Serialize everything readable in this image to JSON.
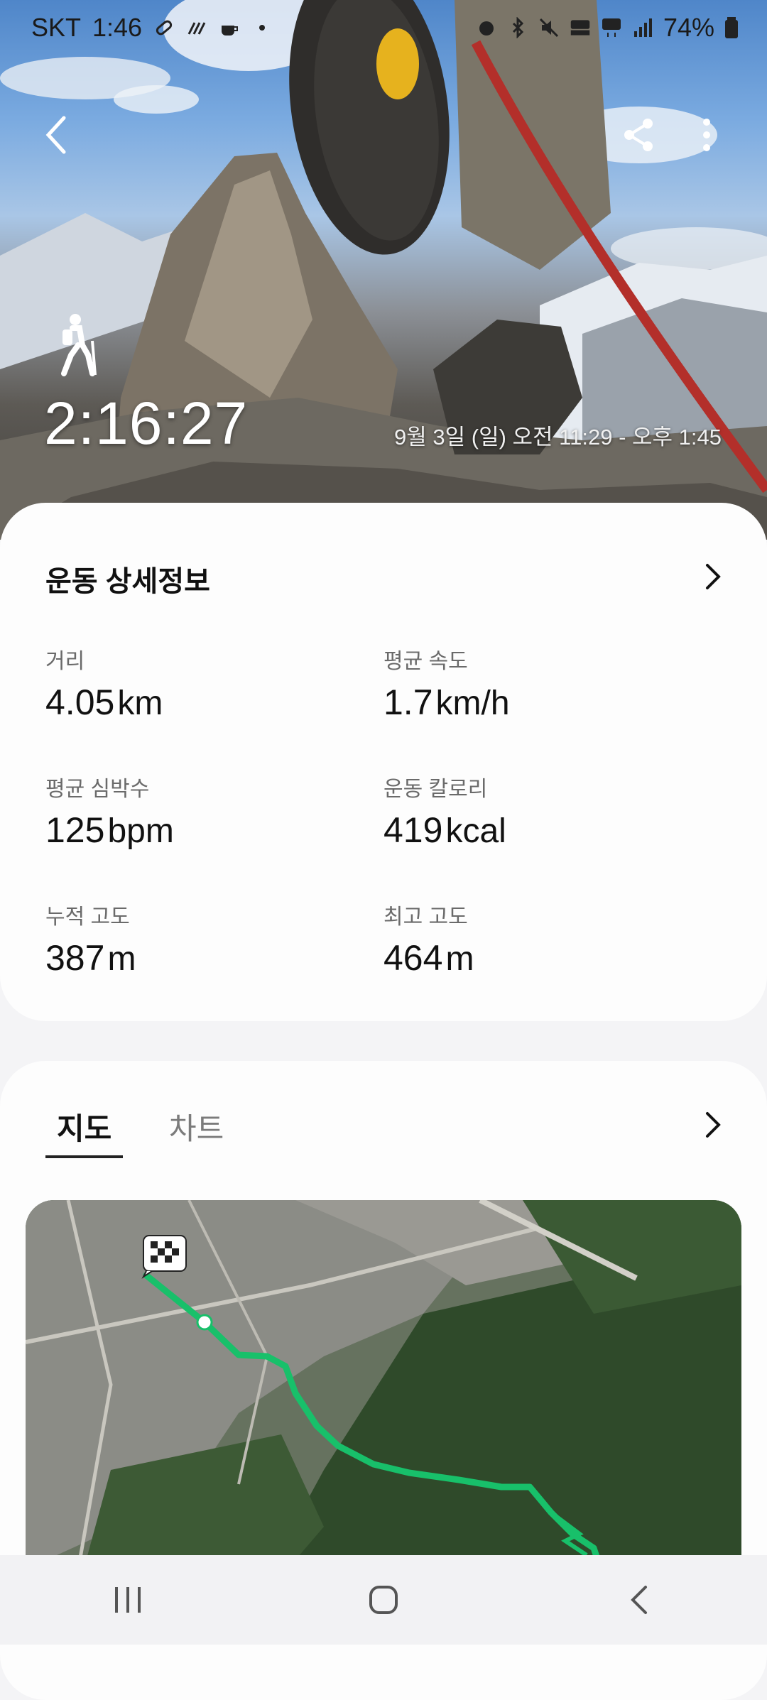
{
  "status_bar": {
    "carrier": "SKT",
    "time": "1:46",
    "battery": "74%",
    "left_icons": [
      "link-icon",
      "signal-bars-icon",
      "coffee-icon",
      "dot-icon"
    ],
    "right_icons": [
      "alarm-icon",
      "bluetooth-icon",
      "mute-icon",
      "hd-voice-icon",
      "5g-icon",
      "signal-icon",
      "battery-icon"
    ]
  },
  "hero": {
    "activity_icon": "hiking-icon",
    "duration": "2:16:27",
    "date_range": "9월 3일 (일) 오전 11:29 - 오후 1:45"
  },
  "details": {
    "title": "운동 상세정보",
    "metrics": [
      {
        "label": "거리",
        "value": "4.05",
        "unit": "km"
      },
      {
        "label": "평균 속도",
        "value": "1.7",
        "unit": "km/h"
      },
      {
        "label": "평균 심박수",
        "value": "125",
        "unit": "bpm"
      },
      {
        "label": "운동 칼로리",
        "value": "419",
        "unit": "kcal"
      },
      {
        "label": "누적 고도",
        "value": "387",
        "unit": "m"
      },
      {
        "label": "최고 고도",
        "value": "464",
        "unit": "m"
      }
    ]
  },
  "map_section": {
    "tabs": [
      {
        "label": "지도",
        "active": true
      },
      {
        "label": "차트",
        "active": false
      }
    ],
    "route_color": "#18c06a"
  },
  "colors": {
    "card_bg": "#fdfdfd",
    "page_bg": "#f4f4f6"
  }
}
